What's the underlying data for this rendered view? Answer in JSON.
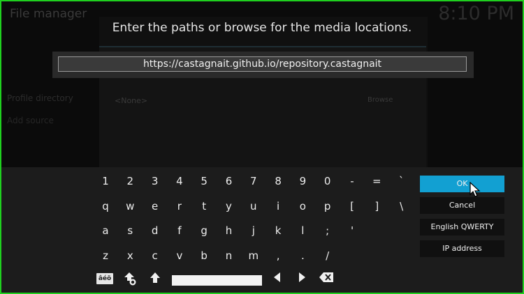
{
  "background": {
    "window_title": "File manager",
    "clock": "8:10 PM",
    "side_items": [
      "Profile directory",
      "Add source"
    ],
    "source_placeholder": "<None>",
    "browse_label": "Browse"
  },
  "dialog": {
    "heading": "Enter the paths or browse for the media locations.",
    "path_value": "https://castagnait.github.io/repository.castagnait"
  },
  "keyboard": {
    "rows": [
      [
        "1",
        "2",
        "3",
        "4",
        "5",
        "6",
        "7",
        "8",
        "9",
        "0",
        "-",
        "=",
        "`"
      ],
      [
        "q",
        "w",
        "e",
        "r",
        "t",
        "y",
        "u",
        "i",
        "o",
        "p",
        "[",
        "]",
        "\\"
      ],
      [
        "a",
        "s",
        "d",
        "f",
        "g",
        "h",
        "j",
        "k",
        "l",
        ";",
        "'"
      ],
      [
        "z",
        "x",
        "c",
        "v",
        "b",
        "n",
        "m",
        ",",
        ".",
        "/"
      ]
    ],
    "accents_label": "âéö",
    "controls": {
      "symbols_icon": "shift-lock-icon",
      "shift_icon": "shift-icon",
      "space_icon": "space-bar",
      "left_icon": "arrow-left-icon",
      "right_icon": "arrow-right-icon",
      "backspace_icon": "backspace-icon"
    }
  },
  "actions": {
    "ok": "OK",
    "cancel": "Cancel",
    "layout": "English QWERTY",
    "ip": "IP address"
  },
  "colors": {
    "accent": "#12a0d2",
    "border": "#1fd01f"
  }
}
